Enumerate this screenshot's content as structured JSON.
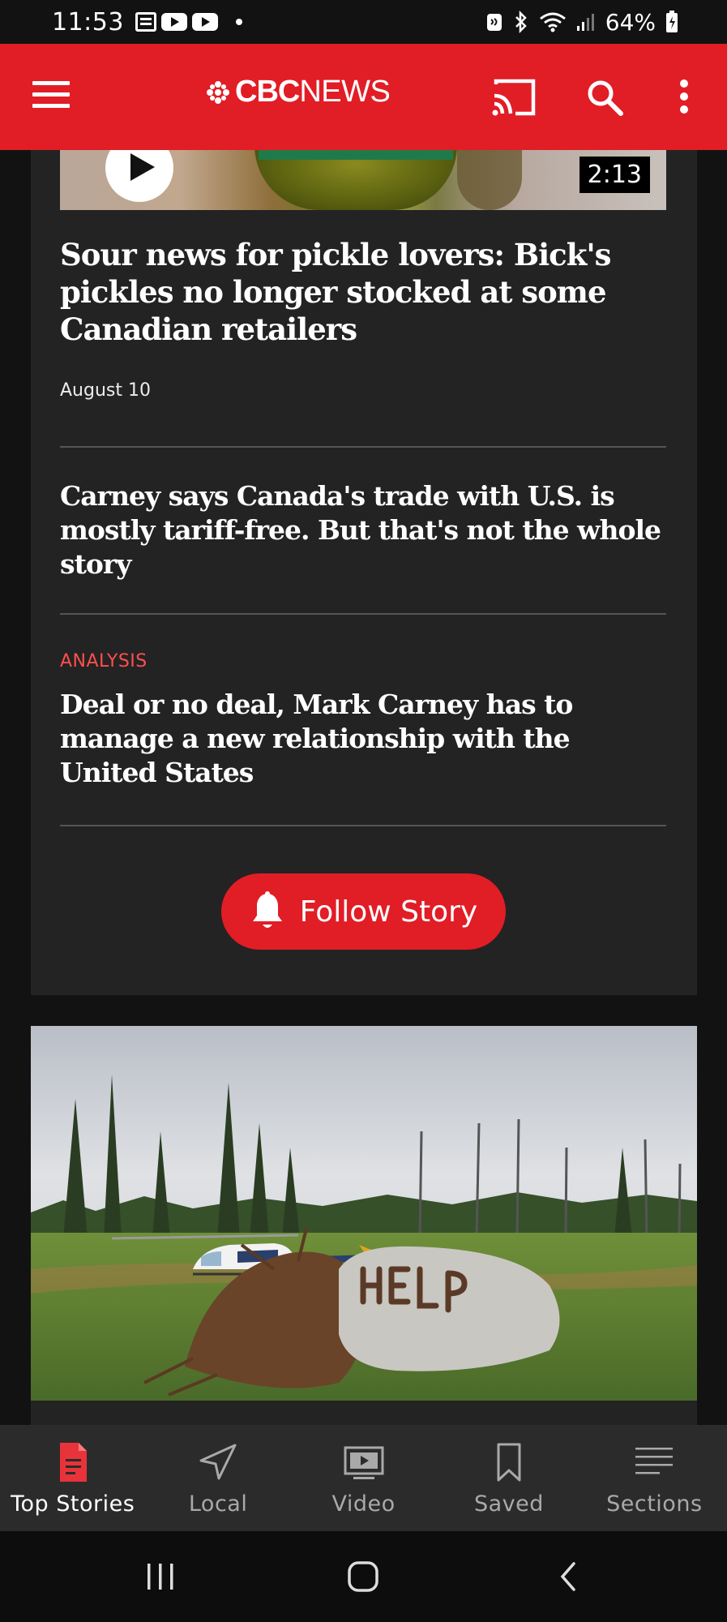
{
  "status_bar": {
    "time": "11:53",
    "battery": "64%",
    "icons": [
      "calendar-icon",
      "youtube-icon",
      "youtube-icon",
      "dot-icon",
      "nfc-icon",
      "bluetooth-icon",
      "wifi-icon",
      "signal-icon",
      "battery-icon"
    ]
  },
  "app_bar": {
    "brand_cbc": "CBC",
    "brand_news": "NEWS",
    "background": "#e11d26",
    "icons": [
      "menu-icon",
      "cast-icon",
      "search-icon",
      "more-vertical-icon"
    ]
  },
  "stories": [
    {
      "title": "Sour news for pickle lovers: Bick's pickles no longer stocked at some Canadian retailers",
      "date": "August 10",
      "video_duration": "2:13"
    },
    {
      "title": "Carney says Canada's trade with U.S. is mostly tariff-free. But that's not the whole story"
    },
    {
      "label": "ANALYSIS",
      "title": "Deal or no deal, Mark Carney has to manage a new relationship with the United States"
    }
  ],
  "follow_button": {
    "label": "Follow Story",
    "icon": "bell-icon"
  },
  "bottom_nav": {
    "items": [
      {
        "label": "Top Stories",
        "icon": "document-icon",
        "active": true
      },
      {
        "label": "Local",
        "icon": "location-arrow-icon",
        "active": false
      },
      {
        "label": "Video",
        "icon": "video-icon",
        "active": false
      },
      {
        "label": "Saved",
        "icon": "bookmark-icon",
        "active": false
      },
      {
        "label": "Sections",
        "icon": "sections-icon",
        "active": false
      }
    ]
  },
  "system_nav": {
    "icons": [
      "recents-icon",
      "home-icon",
      "back-icon"
    ]
  },
  "colors": {
    "accent": "#e11d26",
    "analysis_label": "#ff4e4e",
    "card_bg": "#232323",
    "page_bg": "#121212"
  }
}
